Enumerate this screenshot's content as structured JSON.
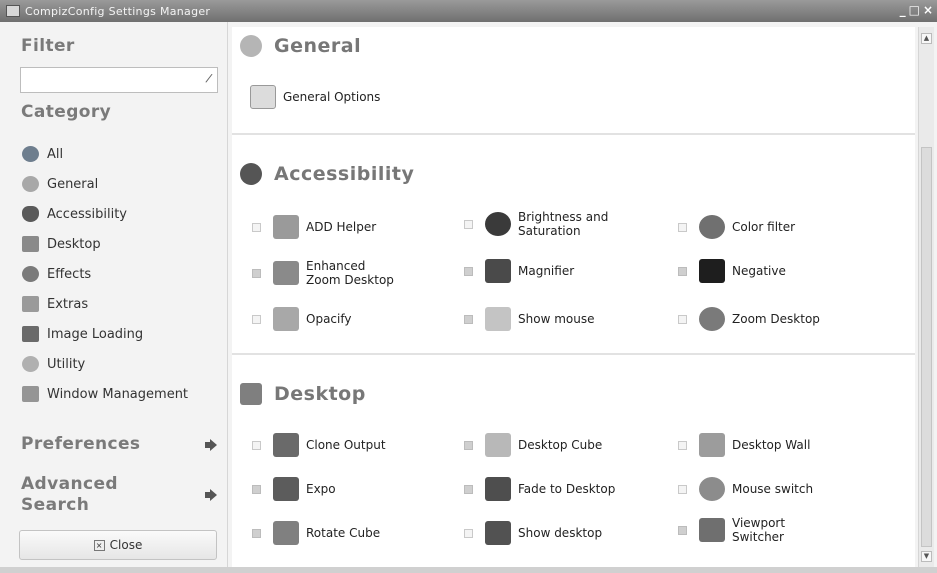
{
  "window": {
    "title": "CompizConfig Settings Manager",
    "controls": [
      "_",
      "□",
      "×"
    ]
  },
  "sidebar": {
    "filter_heading": "Filter",
    "filter_value": "",
    "category_heading": "Category",
    "categories": [
      {
        "label": "All",
        "icon": "globe-icon",
        "color": "#6e7e8e"
      },
      {
        "label": "General",
        "icon": "gear-icon",
        "color": "#a8a8a8"
      },
      {
        "label": "Accessibility",
        "icon": "wheelchair-icon",
        "color": "#5a5a5a"
      },
      {
        "label": "Desktop",
        "icon": "desktop-icon",
        "color": "#8a8a8a"
      },
      {
        "label": "Effects",
        "icon": "effects-icon",
        "color": "#7a7a7a"
      },
      {
        "label": "Extras",
        "icon": "extras-icon",
        "color": "#9a9a9a"
      },
      {
        "label": "Image Loading",
        "icon": "image-icon",
        "color": "#6a6a6a"
      },
      {
        "label": "Utility",
        "icon": "utility-icon",
        "color": "#b0b0b0"
      },
      {
        "label": "Window Management",
        "icon": "window-icon",
        "color": "#959595"
      }
    ],
    "preferences": "Preferences",
    "advanced_search": "Advanced\nSearch",
    "close_label": "Close"
  },
  "sections": [
    {
      "title": "General",
      "icon": "gear-icon",
      "plugins": [
        {
          "label": "General Options",
          "enabled": null
        }
      ]
    },
    {
      "title": "Accessibility",
      "icon": "wheelchair-icon",
      "plugins": [
        {
          "label": "ADD Helper",
          "enabled": false
        },
        {
          "label": "Brightness and\nSaturation",
          "enabled": false
        },
        {
          "label": "Color filter",
          "enabled": false
        },
        {
          "label": "Enhanced\nZoom Desktop",
          "enabled": true
        },
        {
          "label": "Magnifier",
          "enabled": true
        },
        {
          "label": "Negative",
          "enabled": true
        },
        {
          "label": "Opacify",
          "enabled": false
        },
        {
          "label": "Show mouse",
          "enabled": true
        },
        {
          "label": "Zoom Desktop",
          "enabled": false
        }
      ]
    },
    {
      "title": "Desktop",
      "icon": "desktop-icon",
      "plugins": [
        {
          "label": "Clone Output",
          "enabled": false
        },
        {
          "label": "Desktop Cube",
          "enabled": true
        },
        {
          "label": "Desktop Wall",
          "enabled": false
        },
        {
          "label": "Expo",
          "enabled": true
        },
        {
          "label": "Fade to Desktop",
          "enabled": true
        },
        {
          "label": "Mouse switch",
          "enabled": false
        },
        {
          "label": "Rotate Cube",
          "enabled": true
        },
        {
          "label": "Show desktop",
          "enabled": false
        },
        {
          "label": "Viewport\nSwitcher",
          "enabled": true
        }
      ]
    }
  ],
  "colors": {
    "heading": "#7a7a7a",
    "titlebar": "#7f7f7f",
    "background": "#f3f3f3"
  }
}
